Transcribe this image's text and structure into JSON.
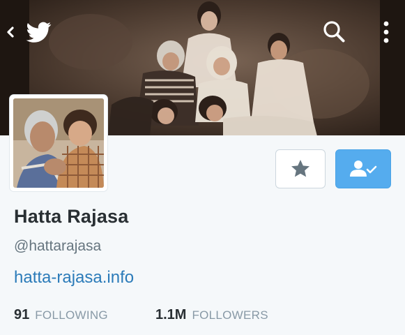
{
  "nav": {
    "back_icon": "chevron-left-icon",
    "logo_icon": "twitter-bird-icon",
    "search_icon": "search-icon",
    "more_icon": "vertical-dots-icon"
  },
  "profile": {
    "name": "Hatta Rajasa",
    "handle": "@hattarajasa",
    "url": "hatta-rajasa.info",
    "following_count": "91",
    "following_label": "FOLLOWING",
    "followers_count": "1.1M",
    "followers_label": "FOLLOWERS"
  },
  "actions": {
    "favorite_icon": "star-icon",
    "follow_icon": "person-check-icon"
  },
  "colors": {
    "accent": "#55acee",
    "link": "#2b7bb9",
    "text": "#292f33",
    "muted": "#8899a6"
  }
}
